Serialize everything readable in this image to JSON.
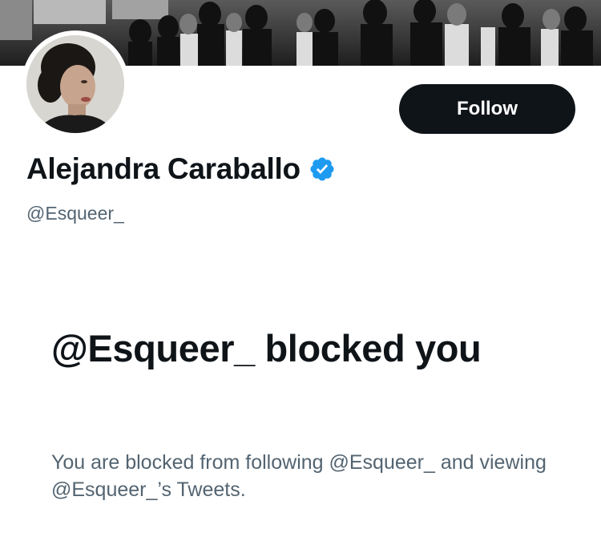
{
  "profile": {
    "display_name": "Alejandra Caraballo",
    "handle": "@Esqueer_",
    "verified_badge": "verified-checkmark-icon",
    "banner": "black-and-white-crowd-photo",
    "avatar": "profile-photo"
  },
  "actions": {
    "follow_label": "Follow"
  },
  "blocked_notice": {
    "title": "@Esqueer_ blocked you",
    "description": "You are blocked from following @Esqueer_ and viewing @Esqueer_’s Tweets."
  },
  "colors": {
    "button_bg": "#0f1419",
    "button_text": "#ffffff",
    "primary_text": "#0f1419",
    "secondary_text": "#536471",
    "verified_blue": "#1d9bf0"
  }
}
